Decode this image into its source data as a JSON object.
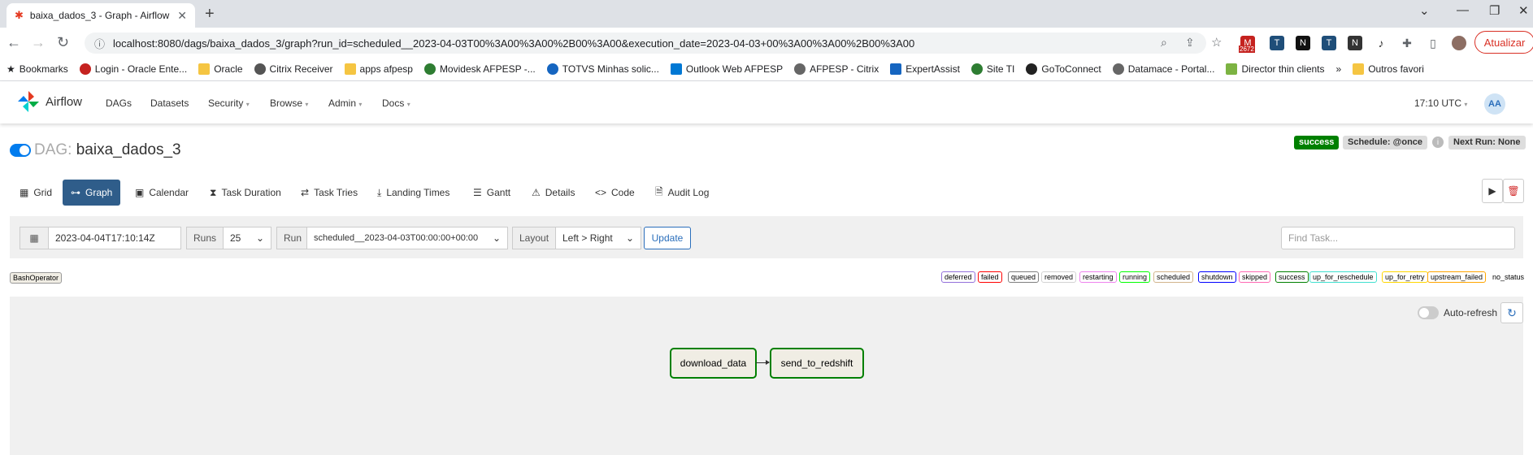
{
  "browser": {
    "tab_title": "baixa_dados_3 - Graph - Airflow",
    "url": "localhost:8080/dags/baixa_dados_3/graph?run_id=scheduled__2023-04-03T00%3A00%3A00%2B00%3A00&execution_date=2023-04-03+00%3A00%3A00%2B00%3A00",
    "ext_badge": "2672",
    "update_label": "Atualizar",
    "bookmarks": [
      "Bookmarks",
      "Login - Oracle Ente...",
      "Oracle",
      "Citrix Receiver",
      "apps afpesp",
      "Movidesk AFPESP -...",
      "TOTVS Minhas solic...",
      "Outlook Web AFPESP",
      "AFPESP - Citrix",
      "ExpertAssist",
      "Site TI",
      "GoToConnect",
      "Datamace - Portal...",
      "Director thin clients",
      "Outros favori"
    ]
  },
  "nav": {
    "brand": "Airflow",
    "menu": [
      "DAGs",
      "Datasets",
      "Security",
      "Browse",
      "Admin",
      "Docs"
    ],
    "time": "17:10 UTC",
    "avatar": "AA"
  },
  "dag": {
    "prefix": "DAG:",
    "name": "baixa_dados_3",
    "status": "success",
    "schedule": "Schedule: @once",
    "next_run": "Next Run: None"
  },
  "tabs": [
    "Grid",
    "Graph",
    "Calendar",
    "Task Duration",
    "Task Tries",
    "Landing Times",
    "Gantt",
    "Details",
    "Code",
    "Audit Log"
  ],
  "filters": {
    "date": "2023-04-04T17:10:14Z",
    "runs_label": "Runs",
    "runs_value": "25",
    "run_label": "Run",
    "run_value": "scheduled__2023-04-03T00:00:00+00:00",
    "layout_label": "Layout",
    "layout_value": "Left > Right",
    "update": "Update",
    "find_placeholder": "Find Task..."
  },
  "operator": "BashOperator",
  "legend": [
    {
      "label": "deferred",
      "color": "#9370db"
    },
    {
      "label": "failed",
      "color": "#ff0000"
    },
    {
      "label": "queued",
      "color": "#808080"
    },
    {
      "label": "removed",
      "color": "#d3d3d3"
    },
    {
      "label": "restarting",
      "color": "#ee82ee"
    },
    {
      "label": "running",
      "color": "#00ff00"
    },
    {
      "label": "scheduled",
      "color": "#d2b48c"
    },
    {
      "label": "shutdown",
      "color": "#0000ff"
    },
    {
      "label": "skipped",
      "color": "#ff69b4"
    },
    {
      "label": "success",
      "color": "#008000"
    },
    {
      "label": "up_for_reschedule",
      "color": "#40e0d0"
    },
    {
      "label": "up_for_retry",
      "color": "#ffd700"
    },
    {
      "label": "upstream_failed",
      "color": "#ffa500"
    },
    {
      "label": "no_status",
      "color": "#ffffff"
    }
  ],
  "graph": {
    "auto_refresh": "Auto-refresh",
    "nodes": [
      "download_data",
      "send_to_redshift"
    ]
  }
}
